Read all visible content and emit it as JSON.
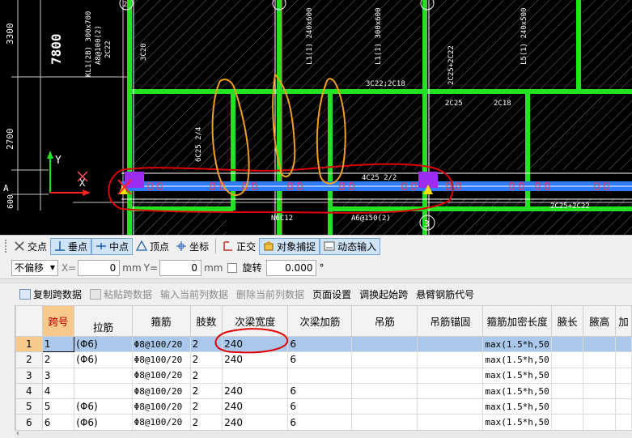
{
  "cad": {
    "dim_left_top": "3300",
    "dim_big": "7800",
    "dim_left_mid": "2700",
    "dim_left_bot": "600",
    "axis_y": "Y",
    "axis_x": "X",
    "axis_A": "A",
    "axis_2": "2",
    "axis_3": "3",
    "labels": [
      "KL1(2B) 300x700",
      "A8@100(2)",
      "2C22",
      "3C20",
      "3C22;2C18",
      "2C25+2C22",
      "2C25",
      "6C25 2/4",
      "2C18",
      "4C25 2/2",
      "N6C12",
      "A6@150(2)",
      "2C25+2C22",
      "L1(1) 240x600",
      "L1(1) 300x600",
      "L5(1) 240x500"
    ]
  },
  "snapbar": {
    "items": [
      "交点",
      "垂点",
      "中点",
      "顶点",
      "坐标",
      "正交",
      "对象捕捉",
      "动态输入"
    ]
  },
  "offsetbar": {
    "mode": "不偏移",
    "x_label": "X=",
    "x_value": "0",
    "y_label": "Y=",
    "y_value": "0",
    "unit_mm": "mm",
    "rotate_label": "旋转",
    "rotate_value": "0.000",
    "degree": "°"
  },
  "toolbar": {
    "copy": "复制跨数据",
    "paste": "粘贴跨数据",
    "input_col": "输入当前列数据",
    "delete_col": "删除当前列数据",
    "page_setup": "页面设置",
    "swap_span": "调换起始跨",
    "cantilever": "悬臂钢筋代号"
  },
  "grid": {
    "headers": [
      "跨号",
      "拉筋",
      "箍筋",
      "肢数",
      "次梁宽度",
      "次梁加筋",
      "吊筋",
      "吊筋锚固",
      "箍筋加密长度",
      "腋长",
      "腋高",
      "加"
    ],
    "rows": [
      {
        "n": "1",
        "span": "1",
        "tie": "(Φ6)",
        "stirrup": "Φ8@100/20",
        "legs": "2",
        "width": "240",
        "add": "6",
        "hang": "",
        "anchor": "",
        "dense": "max(1.5*h,50",
        "haunch_l": "",
        "haunch_h": ""
      },
      {
        "n": "2",
        "span": "2",
        "tie": "(Φ6)",
        "stirrup": "Φ8@100/20",
        "legs": "2",
        "width": "240",
        "add": "6",
        "hang": "",
        "anchor": "",
        "dense": "max(1.5*h,50",
        "haunch_l": "",
        "haunch_h": ""
      },
      {
        "n": "3",
        "span": "3",
        "tie": "",
        "stirrup": "Φ8@100/20",
        "legs": "2",
        "width": "",
        "add": "",
        "hang": "",
        "anchor": "",
        "dense": "max(1.5*h,50",
        "haunch_l": "",
        "haunch_h": ""
      },
      {
        "n": "4",
        "span": "4",
        "tie": "",
        "stirrup": "Φ8@100/20",
        "legs": "2",
        "width": "240",
        "add": "6",
        "hang": "",
        "anchor": "",
        "dense": "max(1.5*h,50",
        "haunch_l": "",
        "haunch_h": ""
      },
      {
        "n": "5",
        "span": "5",
        "tie": "(Φ6)",
        "stirrup": "Φ8@100/20",
        "legs": "2",
        "width": "240",
        "add": "6",
        "hang": "",
        "anchor": "",
        "dense": "max(1.5*h,50",
        "haunch_l": "",
        "haunch_h": ""
      },
      {
        "n": "6",
        "span": "6",
        "tie": "(Φ6)",
        "stirrup": "Φ8@100/20",
        "legs": "2",
        "width": "240",
        "add": "6",
        "hang": "",
        "anchor": "",
        "dense": "max(1.5*h,50",
        "haunch_l": "",
        "haunch_h": ""
      }
    ]
  },
  "colors": {
    "beam_green": "#22e222",
    "beam_blue": "#2f7bff",
    "annot_red": "#e00000",
    "annot_orange": "#f0a020",
    "selected_row": "#a9c8ec",
    "header_highlight": "#f7c98a"
  }
}
